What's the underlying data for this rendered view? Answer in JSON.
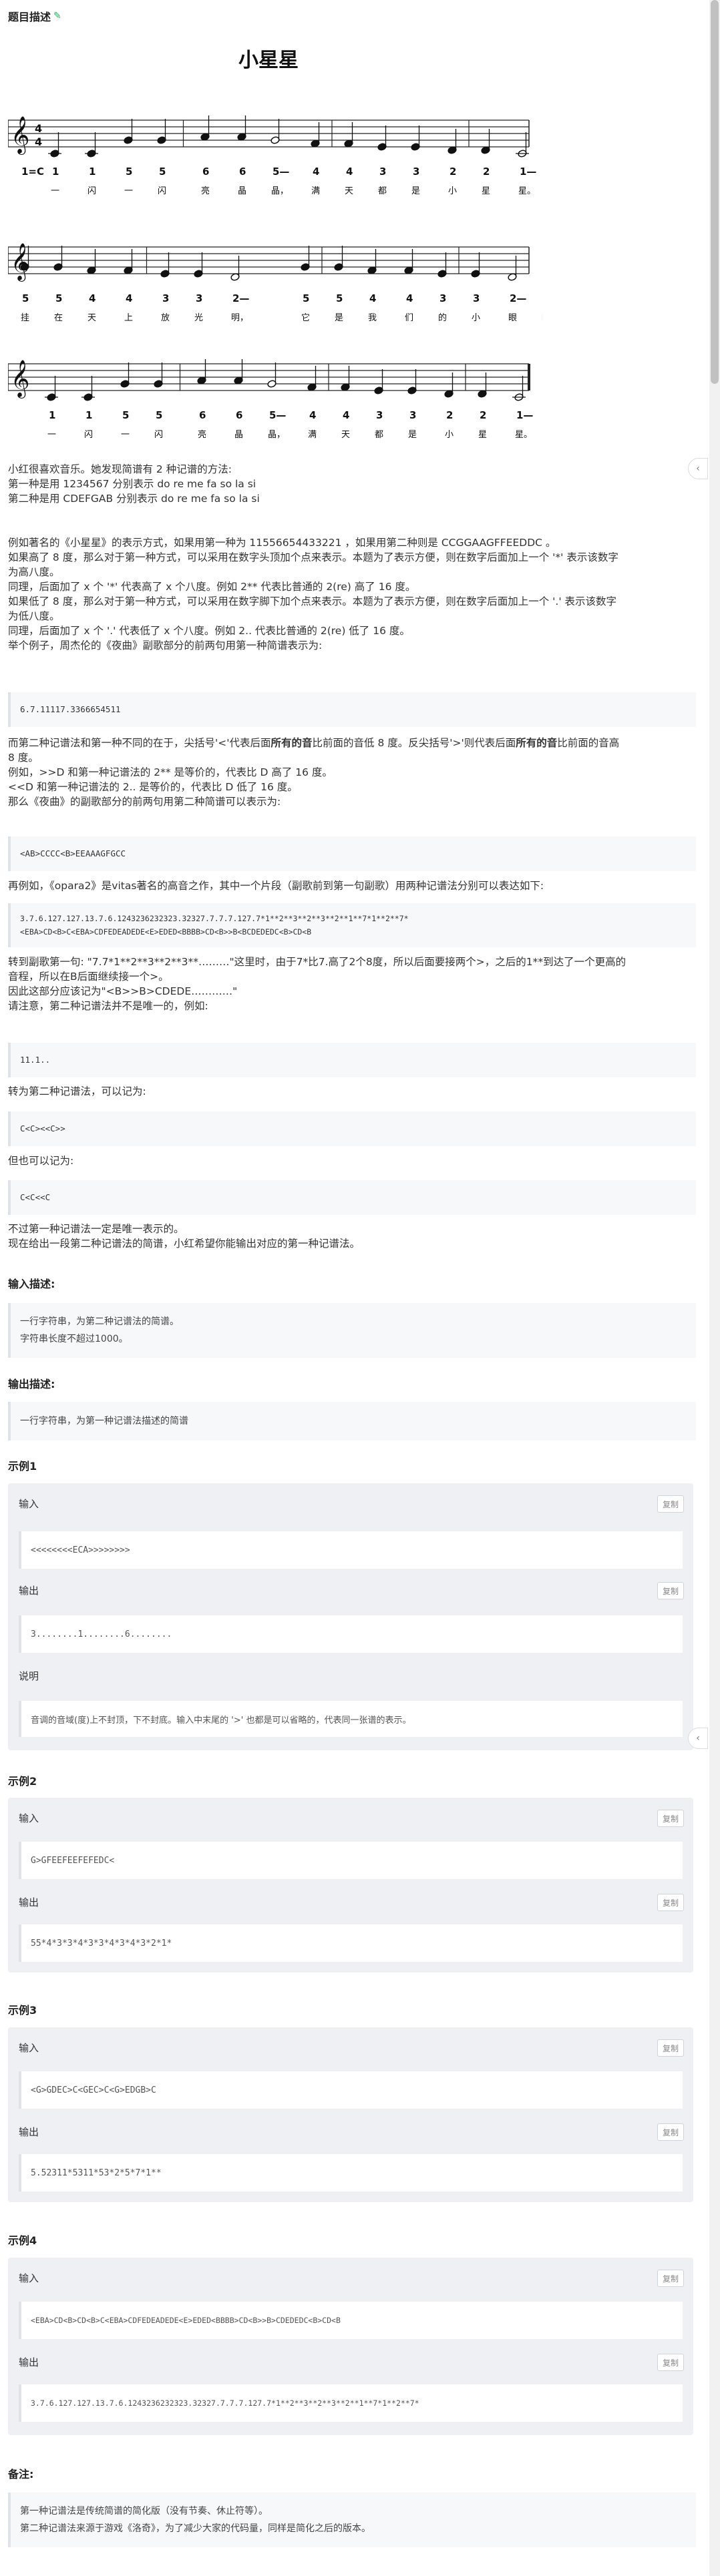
{
  "header": {
    "title": "题目描述",
    "edit_icon": "pencil-icon"
  },
  "score": {
    "title": "小星星",
    "key": "1=C",
    "rows": [
      {
        "nums": [
          "1",
          "1",
          "5",
          "5",
          "6",
          "6",
          "5—",
          "4",
          "4",
          "3",
          "3",
          "2",
          "2",
          "1—"
        ],
        "lyrics": [
          "一",
          "闪",
          "一",
          "闪",
          "亮",
          "晶",
          "晶，",
          "满",
          "天",
          "都",
          "是",
          "小",
          "星",
          "星。"
        ]
      },
      {
        "nums": [
          "5",
          "5",
          "4",
          "4",
          "3",
          "3",
          "2—",
          "5",
          "5",
          "4",
          "4",
          "3",
          "3",
          "2—"
        ],
        "lyrics": [
          "挂",
          "在",
          "天",
          "上",
          "放",
          "光",
          "明，",
          "它",
          "是",
          "我",
          "们",
          "的",
          "小",
          "眼",
          "睛。"
        ]
      },
      {
        "nums": [
          "1",
          "1",
          "5",
          "5",
          "6",
          "6",
          "5—",
          "4",
          "4",
          "3",
          "3",
          "2",
          "2",
          "1—"
        ],
        "lyrics": [
          "一",
          "闪",
          "一",
          "闪",
          "亮",
          "晶",
          "晶，",
          "满",
          "天",
          "都",
          "是",
          "小",
          "星",
          "星。"
        ]
      }
    ]
  },
  "desc": {
    "p1": [
      "小红很喜欢音乐。她发现简谱有 2 种记谱的方法:",
      "第一种是用 1234567 分别表示 do re me fa so la si",
      "第二种是用 CDEFGAB 分别表示 do re me fa so la si"
    ],
    "p2": [
      "例如著名的《小星星》的表示方式，如果用第一种为 11556654433221 ，如果用第二种则是 CCGGAAGFFEEDDC 。",
      "如果高了 8 度，那么对于第一种方式，可以采用在数字头顶加个点来表示。本题为了表示方便，则在数字后面加上一个 '*' 表示该数字",
      "为高八度。",
      "同理，后面加了 x 个 '*' 代表高了 x 个八度。例如 2** 代表比普通的 2(re) 高了 16 度。",
      "如果低了 8 度，那么对于第一种方式，可以采用在数字脚下加个点来表示。本题为了表示方便，则在数字后面加上一个 '.' 表示该数字",
      "为低八度。",
      "同理，后面加了 x 个 '.' 代表低了 x 个八度。例如 2.. 代表比普通的 2(re) 低了 16 度。",
      "举个例子，周杰伦的《夜曲》副歌部分的前两句用第一种简谱表示为:"
    ],
    "code1": "6.7.11117.3366654511",
    "p3a": "而第二种记谱法和第一种不同的在于，尖括号'<'代表后面",
    "p3b": "所有的音",
    "p3c": "比前面的音低 8 度。反尖括号'>'则代表后面",
    "p3d": "所有的音",
    "p3e": "比前面的音高",
    "p3f": "8 度。",
    "p4": [
      "例如，>>D 和第一种记谱法的 2** 是等价的，代表比 D 高了 16 度。",
      "<<D 和第一种记谱法的 2.. 是等价的，代表比 D 低了 16 度。",
      "那么《夜曲》的副歌部分的前两句用第二种简谱可以表示为:"
    ],
    "code2": "<AB>CCCC<B>EEAAAGFGCC",
    "p5": "再例如，《opara2》是vitas著名的高音之作，其中一个片段（副歌前到第一句副歌）用两种记谱法分别可以表达如下:",
    "code3": [
      "3.7.6.127.127.13.7.6.1243236232323.32327.7.7.7.127.7*1**2**3**2**3**2**1**7*1**2**7*",
      "<EBA>CD<B>C<EBA>CDFEDEADEDE<E>EDED<BBBB>CD<B>>B<BCDEDEDC<B>CD<B"
    ],
    "p6": [
      "转到副歌第一句: \"7.7*1**2**3**2**3**………\"这里时，由于7*比7.高了2个8度，所以后面要接两个>，之后的1**到达了一个更高的",
      "音程，所以在B后面继续接一个>。",
      "因此这部分应该记为\"<B>>B>CDEDE…………\"",
      "请注意，第二种记谱法并不是唯一的，例如:"
    ],
    "code4": "11.1..",
    "p7": "转为第二种记谱法，可以记为:",
    "code5": "C<C><<C>>",
    "p8": "但也可以记为:",
    "code6": "C<C<<C",
    "p9": [
      "不过第一种记谱法一定是唯一表示的。",
      "现在给出一段第二种记谱法的简谱，小红希望你能输出对应的第一种记谱法。"
    ]
  },
  "input_desc": {
    "title": "输入描述:",
    "lines": [
      "一行字符串，为第二种记谱法的简谱。",
      "字符串长度不超过1000。"
    ]
  },
  "output_desc": {
    "title": "输出描述:",
    "lines": [
      "一行字符串，为第一种记谱法描述的简谱"
    ]
  },
  "labels": {
    "input": "输入",
    "output": "输出",
    "explain": "说明",
    "copy": "复制"
  },
  "samples": [
    {
      "title": "示例1",
      "input": "<<<<<<<<ECA>>>>>>>>",
      "output": "3........1........6........",
      "explain": "音调的音域(度)上不封顶，下不封底。输入中末尾的 '>' 也都是可以省略的，代表同一张谱的表示。"
    },
    {
      "title": "示例2",
      "input": "G>GFEEFEEFEFEDC<",
      "output": "55*4*3*3*4*3*3*4*3*4*3*2*1*"
    },
    {
      "title": "示例3",
      "input": "<G>GDEC>C<GEC>C<G>EDGB>C",
      "output": "5.52311*5311*53*2*5*7*1**"
    },
    {
      "title": "示例4",
      "input": "<EBA>CD<B>CD<B>C<EBA>CDFEDEADEDE<E>EDED<BBBB>CD<B>>B>CDEDEDC<B>CD<B",
      "output": "3.7.6.127.127.13.7.6.1243236232323.32327.7.7.7.127.7*1**2**3**2**3**2**1**7*1**2**7*"
    }
  ],
  "remarks": {
    "title": "备注:",
    "lines": [
      "第一种记谱法是传统简谱的简化版（没有节奏、休止符等）。",
      "第二种记谱法来源于游戏《洛奇》，为了减少大家的代码量，同样是简化之后的版本。"
    ]
  }
}
